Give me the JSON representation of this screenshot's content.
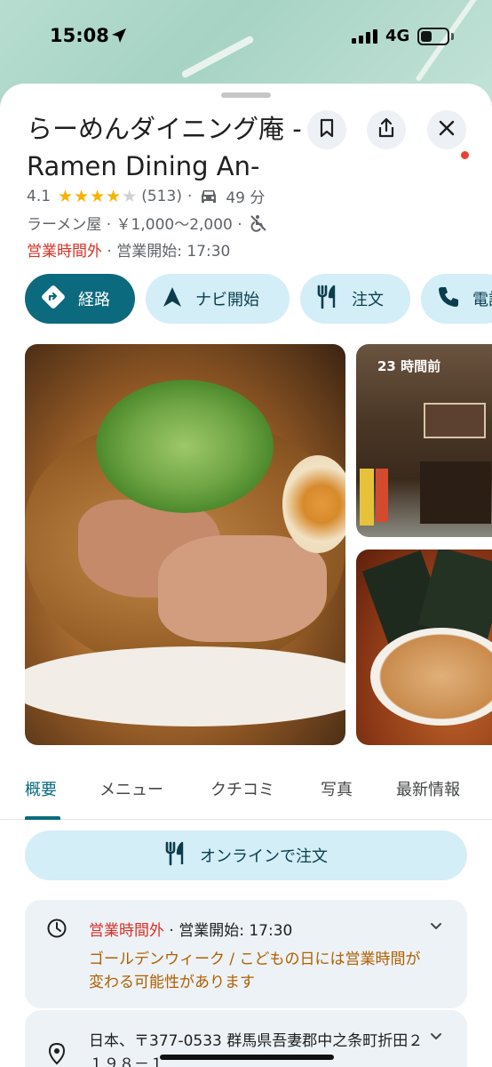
{
  "status_bar": {
    "time": "15:08",
    "network": "4G"
  },
  "place": {
    "title": "らーめんダイニング庵 -Ramen Dining An-",
    "rating": "4.1",
    "stars": "★★★★",
    "star_empty": "★",
    "review_count": "(513)",
    "sep": "·",
    "drive_time": "49 分",
    "category_price": "ラーメン屋 · ￥1,000～2,000 ·",
    "status_closed": "営業時間外",
    "status_opens": " · 営業開始: 17:30"
  },
  "actions": {
    "directions": "経路",
    "navigate": "ナビ開始",
    "order": "注文",
    "call": "電話"
  },
  "photos": {
    "recent_label": "23 時間前"
  },
  "tabs": [
    {
      "label": "概要"
    },
    {
      "label": "メニュー"
    },
    {
      "label": "クチコミ"
    },
    {
      "label": "写真"
    },
    {
      "label": "最新情報"
    }
  ],
  "online_order": "オンラインで注文",
  "hours_card": {
    "status_closed": "営業時間外",
    "status_opens": " · 営業開始: 17:30",
    "notice": "ゴールデンウィーク / こどもの日には営業時間が変わる可能性があります"
  },
  "address_card": {
    "address": "日本、〒377-0533 群馬県吾妻郡中之条町折田２１９８－１"
  },
  "colors": {
    "accent": "#0b6a7d",
    "chip_bg": "#d3eef7",
    "closed": "#d93025",
    "notice": "#b06000",
    "star": "#f4b400"
  },
  "icons": [
    "location-arrow-icon",
    "signal-icon",
    "battery-icon",
    "bookmark-icon",
    "share-icon",
    "close-icon",
    "car-icon",
    "no-wheelchair-icon",
    "directions-icon",
    "navigation-icon",
    "utensils-icon",
    "phone-icon",
    "clock-icon",
    "chevron-down-icon",
    "map-pin-icon"
  ]
}
